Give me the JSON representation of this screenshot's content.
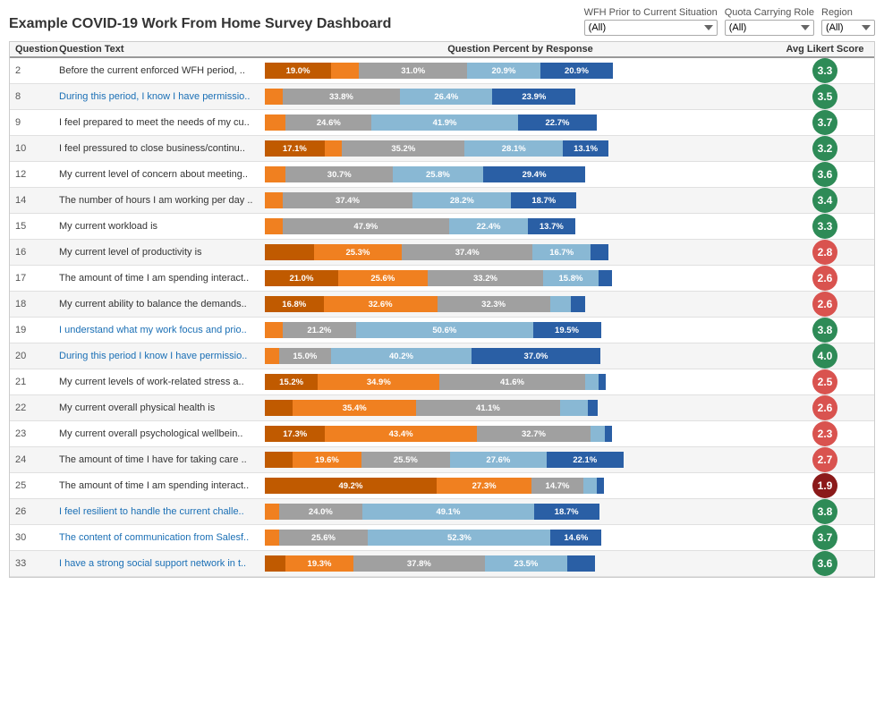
{
  "title": "Example COVID-19 Work From Home Survey Dashboard",
  "filters": {
    "wfh_label": "WFH Prior to Current Situation",
    "wfh_value": "(All)",
    "quota_label": "Quota Carrying Role",
    "quota_value": "(All)",
    "region_label": "Region",
    "region_value": "(All)"
  },
  "table": {
    "col_question": "Question",
    "col_qtext": "Question Text",
    "col_chart": "Question Percent by Response",
    "col_score": "Avg Likert Score"
  },
  "rows": [
    {
      "q": "2",
      "text": "Before the current enforced WFH period, ..",
      "blue_link": false,
      "segments": [
        {
          "color": "orange-dark",
          "pct": 19.0,
          "label": "19.0%"
        },
        {
          "color": "orange",
          "pct": 8.0,
          "label": ""
        },
        {
          "color": "gray",
          "pct": 31.0,
          "label": "31.0%"
        },
        {
          "color": "blue-light",
          "pct": 20.9,
          "label": "20.9%"
        },
        {
          "color": "blue",
          "pct": 20.9,
          "label": "20.9%"
        }
      ],
      "score": "3.3",
      "score_type": "green"
    },
    {
      "q": "8",
      "text": "During this period, I know I have permissio..",
      "blue_link": true,
      "segments": [
        {
          "color": "orange",
          "pct": 5.0,
          "label": ""
        },
        {
          "color": "gray",
          "pct": 33.8,
          "label": "33.8%"
        },
        {
          "color": "blue-light",
          "pct": 26.4,
          "label": "26.4%"
        },
        {
          "color": "blue",
          "pct": 23.9,
          "label": "23.9%"
        }
      ],
      "score": "3.5",
      "score_type": "green"
    },
    {
      "q": "9",
      "text": "I feel prepared to meet the needs of my cu..",
      "blue_link": false,
      "segments": [
        {
          "color": "orange",
          "pct": 6.0,
          "label": ""
        },
        {
          "color": "gray",
          "pct": 24.6,
          "label": "24.6%"
        },
        {
          "color": "blue-light",
          "pct": 41.9,
          "label": "41.9%"
        },
        {
          "color": "blue",
          "pct": 22.7,
          "label": "22.7%"
        }
      ],
      "score": "3.7",
      "score_type": "green"
    },
    {
      "q": "10",
      "text": "I feel pressured to close business/continu..",
      "blue_link": false,
      "segments": [
        {
          "color": "orange-dark",
          "pct": 17.1,
          "label": "17.1%"
        },
        {
          "color": "orange",
          "pct": 5.0,
          "label": ""
        },
        {
          "color": "gray",
          "pct": 35.2,
          "label": "35.2%"
        },
        {
          "color": "blue-light",
          "pct": 28.1,
          "label": "28.1%"
        },
        {
          "color": "blue",
          "pct": 13.1,
          "label": "13.1%"
        }
      ],
      "score": "3.2",
      "score_type": "green"
    },
    {
      "q": "12",
      "text": "My current level of concern about meeting..",
      "blue_link": false,
      "segments": [
        {
          "color": "orange",
          "pct": 6.0,
          "label": ""
        },
        {
          "color": "gray",
          "pct": 30.7,
          "label": "30.7%"
        },
        {
          "color": "blue-light",
          "pct": 25.8,
          "label": "25.8%"
        },
        {
          "color": "blue",
          "pct": 29.4,
          "label": "29.4%"
        }
      ],
      "score": "3.6",
      "score_type": "green"
    },
    {
      "q": "14",
      "text": "The number of hours I am working per day ..",
      "blue_link": false,
      "segments": [
        {
          "color": "orange",
          "pct": 5.0,
          "label": ""
        },
        {
          "color": "gray",
          "pct": 37.4,
          "label": "37.4%"
        },
        {
          "color": "blue-light",
          "pct": 28.2,
          "label": "28.2%"
        },
        {
          "color": "blue",
          "pct": 18.7,
          "label": "18.7%"
        }
      ],
      "score": "3.4",
      "score_type": "green"
    },
    {
      "q": "15",
      "text": "My current workload is",
      "blue_link": false,
      "segments": [
        {
          "color": "orange",
          "pct": 5.0,
          "label": ""
        },
        {
          "color": "gray",
          "pct": 47.9,
          "label": "47.9%"
        },
        {
          "color": "blue-light",
          "pct": 22.4,
          "label": "22.4%"
        },
        {
          "color": "blue",
          "pct": 13.7,
          "label": "13.7%"
        }
      ],
      "score": "3.3",
      "score_type": "green"
    },
    {
      "q": "16",
      "text": "My current level of productivity is",
      "blue_link": false,
      "segments": [
        {
          "color": "orange-dark",
          "pct": 14.0,
          "label": ""
        },
        {
          "color": "orange",
          "pct": 25.3,
          "label": "25.3%"
        },
        {
          "color": "gray",
          "pct": 37.4,
          "label": "37.4%"
        },
        {
          "color": "blue-light",
          "pct": 16.7,
          "label": "16.7%"
        },
        {
          "color": "blue",
          "pct": 5.0,
          "label": ""
        }
      ],
      "score": "2.8",
      "score_type": "red"
    },
    {
      "q": "17",
      "text": "The amount of time I am spending interact..",
      "blue_link": false,
      "segments": [
        {
          "color": "orange-dark",
          "pct": 21.0,
          "label": "21.0%"
        },
        {
          "color": "orange",
          "pct": 25.6,
          "label": "25.6%"
        },
        {
          "color": "gray",
          "pct": 33.2,
          "label": "33.2%"
        },
        {
          "color": "blue-light",
          "pct": 15.8,
          "label": "15.8%"
        },
        {
          "color": "blue",
          "pct": 4.0,
          "label": ""
        }
      ],
      "score": "2.6",
      "score_type": "red"
    },
    {
      "q": "18",
      "text": "My current ability to balance the demands..",
      "blue_link": false,
      "segments": [
        {
          "color": "orange-dark",
          "pct": 16.8,
          "label": "16.8%"
        },
        {
          "color": "orange",
          "pct": 32.6,
          "label": "32.6%"
        },
        {
          "color": "gray",
          "pct": 32.3,
          "label": "32.3%"
        },
        {
          "color": "blue-light",
          "pct": 6.0,
          "label": ""
        },
        {
          "color": "blue",
          "pct": 4.0,
          "label": ""
        }
      ],
      "score": "2.6",
      "score_type": "red"
    },
    {
      "q": "19",
      "text": "I understand what my work focus and prio..",
      "blue_link": true,
      "segments": [
        {
          "color": "orange",
          "pct": 5.0,
          "label": ""
        },
        {
          "color": "gray",
          "pct": 21.2,
          "label": "21.2%"
        },
        {
          "color": "blue-light",
          "pct": 50.6,
          "label": "50.6%"
        },
        {
          "color": "blue",
          "pct": 19.5,
          "label": "19.5%"
        }
      ],
      "score": "3.8",
      "score_type": "green"
    },
    {
      "q": "20",
      "text": "During this period I know I have permissio..",
      "blue_link": true,
      "segments": [
        {
          "color": "orange",
          "pct": 4.0,
          "label": ""
        },
        {
          "color": "gray",
          "pct": 15.0,
          "label": "15.0%"
        },
        {
          "color": "blue-light",
          "pct": 40.2,
          "label": "40.2%"
        },
        {
          "color": "blue",
          "pct": 37.0,
          "label": "37.0%"
        }
      ],
      "score": "4.0",
      "score_type": "green"
    },
    {
      "q": "21",
      "text": "My current levels of work-related stress a..",
      "blue_link": false,
      "segments": [
        {
          "color": "orange-dark",
          "pct": 15.2,
          "label": "15.2%"
        },
        {
          "color": "orange",
          "pct": 34.9,
          "label": "34.9%"
        },
        {
          "color": "gray",
          "pct": 41.6,
          "label": "41.6%"
        },
        {
          "color": "blue-light",
          "pct": 4.0,
          "label": ""
        },
        {
          "color": "blue",
          "pct": 2.0,
          "label": ""
        }
      ],
      "score": "2.5",
      "score_type": "red"
    },
    {
      "q": "22",
      "text": "My current overall physical health is",
      "blue_link": false,
      "segments": [
        {
          "color": "orange-dark",
          "pct": 8.0,
          "label": ""
        },
        {
          "color": "orange",
          "pct": 35.4,
          "label": "35.4%"
        },
        {
          "color": "gray",
          "pct": 41.1,
          "label": "41.1%"
        },
        {
          "color": "blue-light",
          "pct": 8.0,
          "label": ""
        },
        {
          "color": "blue",
          "pct": 3.0,
          "label": ""
        }
      ],
      "score": "2.6",
      "score_type": "red"
    },
    {
      "q": "23",
      "text": "My current overall psychological wellbein..",
      "blue_link": false,
      "segments": [
        {
          "color": "orange-dark",
          "pct": 17.3,
          "label": "17.3%"
        },
        {
          "color": "orange",
          "pct": 43.4,
          "label": "43.4%"
        },
        {
          "color": "gray",
          "pct": 32.7,
          "label": "32.7%"
        },
        {
          "color": "blue-light",
          "pct": 4.0,
          "label": ""
        },
        {
          "color": "blue",
          "pct": 2.0,
          "label": ""
        }
      ],
      "score": "2.3",
      "score_type": "red"
    },
    {
      "q": "24",
      "text": "The amount of time I have for taking care ..",
      "blue_link": false,
      "segments": [
        {
          "color": "orange-dark",
          "pct": 8.0,
          "label": ""
        },
        {
          "color": "orange",
          "pct": 19.6,
          "label": "19.6%"
        },
        {
          "color": "gray",
          "pct": 25.5,
          "label": "25.5%"
        },
        {
          "color": "blue-light",
          "pct": 27.6,
          "label": "27.6%"
        },
        {
          "color": "blue",
          "pct": 22.1,
          "label": "22.1%"
        }
      ],
      "score": "2.7",
      "score_type": "red"
    },
    {
      "q": "25",
      "text": "The amount of time I am spending interact..",
      "blue_link": false,
      "segments": [
        {
          "color": "orange-dark",
          "pct": 49.2,
          "label": "49.2%"
        },
        {
          "color": "orange",
          "pct": 27.3,
          "label": "27.3%"
        },
        {
          "color": "gray",
          "pct": 14.7,
          "label": "14.7%"
        },
        {
          "color": "blue-light",
          "pct": 4.0,
          "label": ""
        },
        {
          "color": "blue",
          "pct": 2.0,
          "label": ""
        }
      ],
      "score": "1.9",
      "score_type": "dark-red"
    },
    {
      "q": "26",
      "text": "I feel resilient to handle the current challe..",
      "blue_link": true,
      "segments": [
        {
          "color": "orange",
          "pct": 4.0,
          "label": ""
        },
        {
          "color": "gray",
          "pct": 24.0,
          "label": "24.0%"
        },
        {
          "color": "blue-light",
          "pct": 49.1,
          "label": "49.1%"
        },
        {
          "color": "blue",
          "pct": 18.7,
          "label": "18.7%"
        }
      ],
      "score": "3.8",
      "score_type": "green"
    },
    {
      "q": "30",
      "text": "The content of communication from Salesf..",
      "blue_link": true,
      "segments": [
        {
          "color": "orange",
          "pct": 4.0,
          "label": ""
        },
        {
          "color": "gray",
          "pct": 25.6,
          "label": "25.6%"
        },
        {
          "color": "blue-light",
          "pct": 52.3,
          "label": "52.3%"
        },
        {
          "color": "blue",
          "pct": 14.6,
          "label": "14.6%"
        }
      ],
      "score": "3.7",
      "score_type": "green"
    },
    {
      "q": "33",
      "text": "I have a strong social support network in t..",
      "blue_link": true,
      "segments": [
        {
          "color": "orange-dark",
          "pct": 6.0,
          "label": ""
        },
        {
          "color": "orange",
          "pct": 19.3,
          "label": "19.3%"
        },
        {
          "color": "gray",
          "pct": 37.8,
          "label": "37.8%"
        },
        {
          "color": "blue-light",
          "pct": 23.5,
          "label": "23.5%"
        },
        {
          "color": "blue",
          "pct": 8.0,
          "label": ""
        }
      ],
      "score": "3.6",
      "score_type": "green"
    }
  ]
}
